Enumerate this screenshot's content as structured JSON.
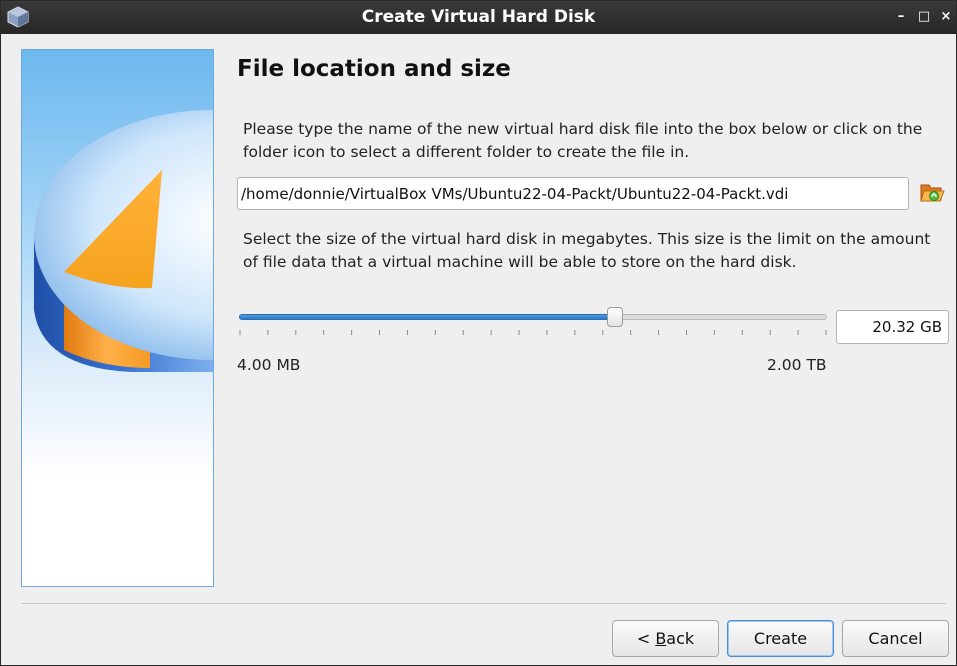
{
  "window": {
    "title": "Create Virtual Hard Disk",
    "controls": {
      "minimize": "–",
      "maximize": "□",
      "close": "×"
    }
  },
  "page": {
    "heading": "File location and size",
    "location_description": "Please type the name of the new virtual hard disk file into the box below or click on the folder icon to select a different folder to create the file in.",
    "file_path": "/home/donnie/VirtualBox VMs/Ubuntu22-04-Packt/Ubuntu22-04-Packt.vdi",
    "size_description": "Select the size of the virtual hard disk in megabytes. This size is the limit on the amount of file data that a virtual machine will be able to store on the hard disk.",
    "size_value": "20.32 GB",
    "slider_min_label": "4.00 MB",
    "slider_max_label": "2.00 TB",
    "slider_position": 0.64,
    "slider_tick_count": 22
  },
  "buttons": {
    "back_prefix": "< ",
    "back_mnemonic": "B",
    "back_rest": "ack",
    "create": "Create",
    "cancel": "Cancel"
  },
  "icons": {
    "app": "virtualbox-icon",
    "folder": "folder-open-icon"
  },
  "colors": {
    "slider_fill": "#2a78c6",
    "accent_border": "#4a8fd6",
    "titlebar": "#262626"
  }
}
